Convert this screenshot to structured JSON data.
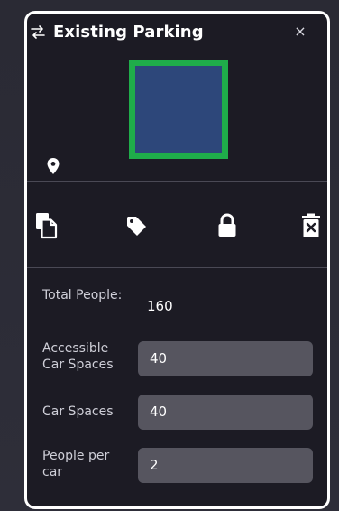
{
  "panel": {
    "title": "Existing Parking",
    "close_label": "×"
  },
  "colors": {
    "thumbnail_fill": "#2d477a",
    "thumbnail_border": "#1fad4a",
    "panel_background": "#1c1b24",
    "input_background": "#56555f"
  },
  "icons": {
    "swap": "swap-icon",
    "close": "close-icon",
    "location": "map-pin-icon",
    "copy": "copy-icon",
    "tag": "tag-icon",
    "lock": "lock-icon",
    "delete": "delete-icon"
  },
  "fields": {
    "total_people": {
      "label": "Total People:",
      "value": "160"
    },
    "accessible_car_spaces": {
      "label": "Accessible Car Spaces",
      "value": "40"
    },
    "car_spaces": {
      "label": "Car Spaces",
      "value": "40"
    },
    "people_per_car": {
      "label": "People per car",
      "value": "2"
    }
  }
}
